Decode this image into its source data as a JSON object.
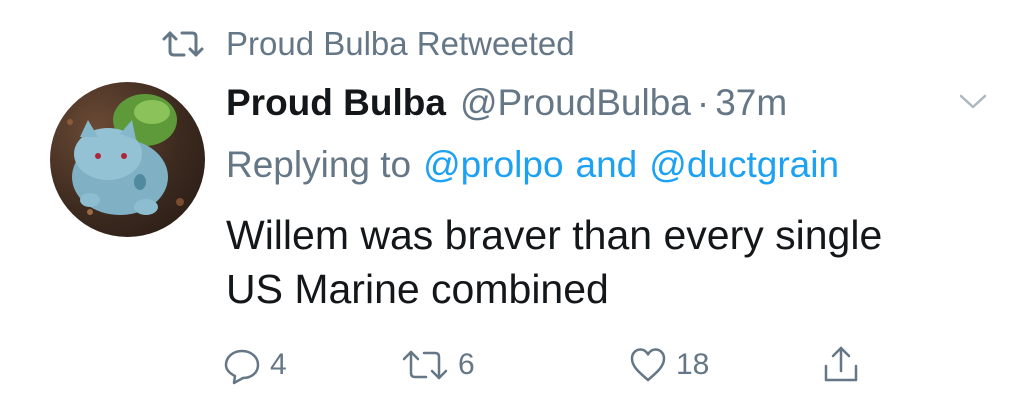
{
  "retweet_context": {
    "icon": "retweet-icon",
    "label": "Proud Bulba Retweeted"
  },
  "tweet": {
    "avatar": "bulbasaur-figure-avatar",
    "display_name": "Proud Bulba",
    "handle": "@ProudBulba",
    "separator": "·",
    "time": "37m",
    "replying_prefix": "Replying to",
    "mention_1": "@prolpo",
    "mention_joiner": "and",
    "mention_2": "@ductgrain",
    "text_line_1": "Willem was braver than every single",
    "text_line_2": "US Marine combined"
  },
  "actions": {
    "reply": {
      "icon": "reply-icon",
      "count": "4"
    },
    "retweet": {
      "icon": "retweet-icon",
      "count": "6"
    },
    "like": {
      "icon": "heart-icon",
      "count": "18"
    },
    "share": {
      "icon": "share-icon"
    }
  },
  "colors": {
    "text": "#14171a",
    "secondary": "#657786",
    "link": "#1da1f2",
    "background": "#ffffff"
  }
}
